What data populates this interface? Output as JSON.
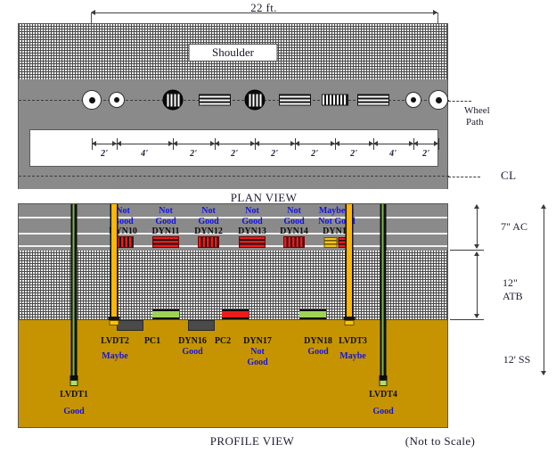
{
  "figure": {
    "plan_view_caption": "PLAN VIEW",
    "profile_view_caption": "PROFILE VIEW",
    "scale_note": "(Not to Scale)"
  },
  "plan": {
    "overall_dimension": "22 ft.",
    "shoulder_label": "Shoulder",
    "wheel_path_label_line1": "Wheel",
    "wheel_path_label_line2": "Path",
    "centerline_label": "CL",
    "spacings": [
      "2'",
      "4'",
      "2'",
      "2'",
      "2'",
      "2'",
      "2'",
      "4'",
      "2'"
    ],
    "sensors": [
      {
        "name": "lvdt-circle-left-outer",
        "glyph": "white-circle-dot"
      },
      {
        "name": "lvdt-circle-left-inner",
        "glyph": "white-circle-dot"
      },
      {
        "name": "dyn-black-disc-1",
        "glyph": "black-disc-vertical-stripes"
      },
      {
        "name": "dyn-bar-horizontal-1",
        "glyph": "white-bar-horizontal-stripes"
      },
      {
        "name": "dyn-black-disc-2",
        "glyph": "black-disc-vertical-stripes"
      },
      {
        "name": "dyn-bar-horizontal-2",
        "glyph": "white-bar-horizontal-stripes"
      },
      {
        "name": "dyn-bar-vertical-1",
        "glyph": "white-bar-vertical-stripes"
      },
      {
        "name": "dyn-bar-horizontal-3",
        "glyph": "white-bar-horizontal-stripes"
      },
      {
        "name": "lvdt-circle-right-inner",
        "glyph": "white-circle-dot"
      },
      {
        "name": "lvdt-circle-right-outer",
        "glyph": "white-circle-dot"
      }
    ]
  },
  "profile": {
    "layers": [
      {
        "id": "ac",
        "label": "7\" AC"
      },
      {
        "id": "atb",
        "label": "12\" ATB"
      },
      {
        "id": "ss",
        "label": "12' SS"
      }
    ],
    "ac_sensors": [
      {
        "id": "DYN10",
        "status_line1": "Not",
        "status_line2": "Good",
        "glyph": "vertical-stripe-red"
      },
      {
        "id": "DYN11",
        "status_line1": "Not",
        "status_line2": "Good",
        "glyph": "horizontal-stripe-red"
      },
      {
        "id": "DYN12",
        "status_line1": "Not",
        "status_line2": "Good",
        "glyph": "vertical-stripe-red"
      },
      {
        "id": "DYN13",
        "status_line1": "Not",
        "status_line2": "Good",
        "glyph": "horizontal-stripe-red"
      },
      {
        "id": "DYN14",
        "status_line1": "Not",
        "status_line2": "Good",
        "glyph": "vertical-stripe-red"
      },
      {
        "id": "DYN15",
        "status_line1": "Maybe &",
        "status_line2": "Not Good",
        "glyph": "yellow-and-red-pair"
      }
    ],
    "deep_instruments": [
      {
        "id": "LVDT2",
        "status": "Maybe",
        "type": "rod-yellow"
      },
      {
        "id": "PC1",
        "status": "",
        "type": "pressure-cell"
      },
      {
        "id": "DYN16",
        "status": "Good",
        "type": "green-gauge"
      },
      {
        "id": "PC2",
        "status": "",
        "type": "pressure-cell"
      },
      {
        "id": "DYN17",
        "status_line1": "Not",
        "status_line2": "Good",
        "status": "Not Good",
        "type": "red-gauge"
      },
      {
        "id": "DYN18",
        "status": "Good",
        "type": "green-gauge"
      },
      {
        "id": "LVDT3",
        "status": "Maybe",
        "type": "rod-yellow"
      }
    ],
    "deep_lvdts": [
      {
        "id": "LVDT1",
        "status": "Good",
        "type": "rod-green-deep"
      },
      {
        "id": "LVDT4",
        "status": "Good",
        "type": "rod-green-deep"
      }
    ]
  },
  "colors": {
    "subgrade": "#c59400",
    "asphalt": "#8a8a8a",
    "status_blue": "#1414e0",
    "sensor_red": "#ef1b1b",
    "sensor_green": "#9ed357",
    "sensor_yellow": "#ffc400"
  }
}
